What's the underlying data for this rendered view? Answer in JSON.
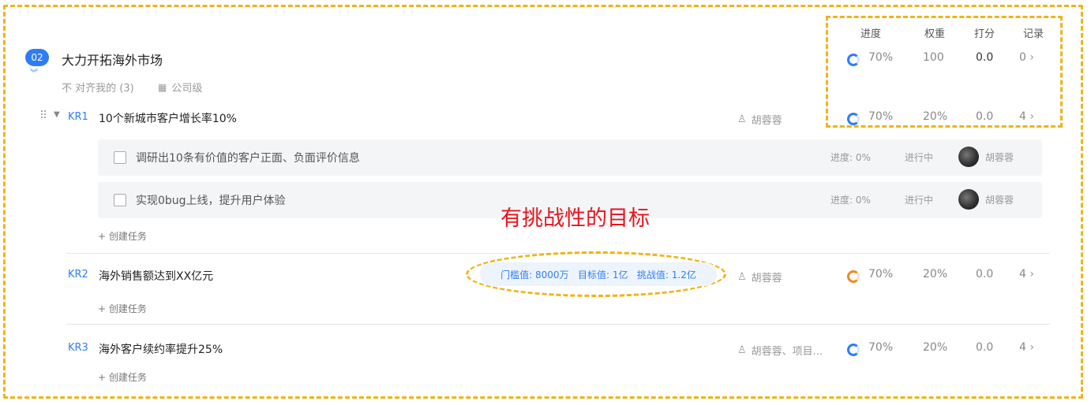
{
  "columns": {
    "progress": "进度",
    "weight": "权重",
    "score": "打分",
    "record": "记录"
  },
  "objective": {
    "badge": "02",
    "title": "大力开拓海外市场",
    "align_label": "不 对齐我的 (3)",
    "level_label": "公司级",
    "progress": "70%",
    "weight": "100",
    "score": "0.0",
    "record": "0"
  },
  "krs": [
    {
      "label": "KR1",
      "title": "10个新城市客户增长率10%",
      "owner": "胡蓉蓉",
      "progress": "70%",
      "weight": "20%",
      "score": "0.0",
      "record": "4"
    },
    {
      "label": "KR2",
      "title": "海外销售额达到XX亿元",
      "owner": "胡蓉蓉",
      "progress": "70%",
      "weight": "20%",
      "score": "0.0",
      "record": "4"
    },
    {
      "label": "KR3",
      "title": "海外客户续约率提升25%",
      "owner": "胡蓉蓉、项目...",
      "progress": "70%",
      "weight": "20%",
      "score": "0.0",
      "record": "4"
    }
  ],
  "tasks": [
    {
      "text": "调研出10条有价值的客户正面、负面评价信息",
      "progress": "进度: 0%",
      "status": "进行中",
      "owner": "胡蓉蓉"
    },
    {
      "text": "实现0bug上线，提升用户体验",
      "progress": "进度: 0%",
      "status": "进行中",
      "owner": "胡蓉蓉"
    }
  ],
  "create_task": "+ 创建任务",
  "thresholds": "门槛值: 8000万   目标值: 1亿   挑战值: 1.2亿",
  "callout": "有挑战性的目标",
  "colors": {
    "accent": "#2f7df6",
    "annotation": "#f2b314",
    "callout": "#e8141c",
    "ring_orange": "#f08a24"
  },
  "icons": [
    "drag-handle-icon",
    "caret-down-icon",
    "user-icon",
    "building-icon",
    "chevron-right-icon",
    "progress-ring-icon",
    "avatar"
  ]
}
